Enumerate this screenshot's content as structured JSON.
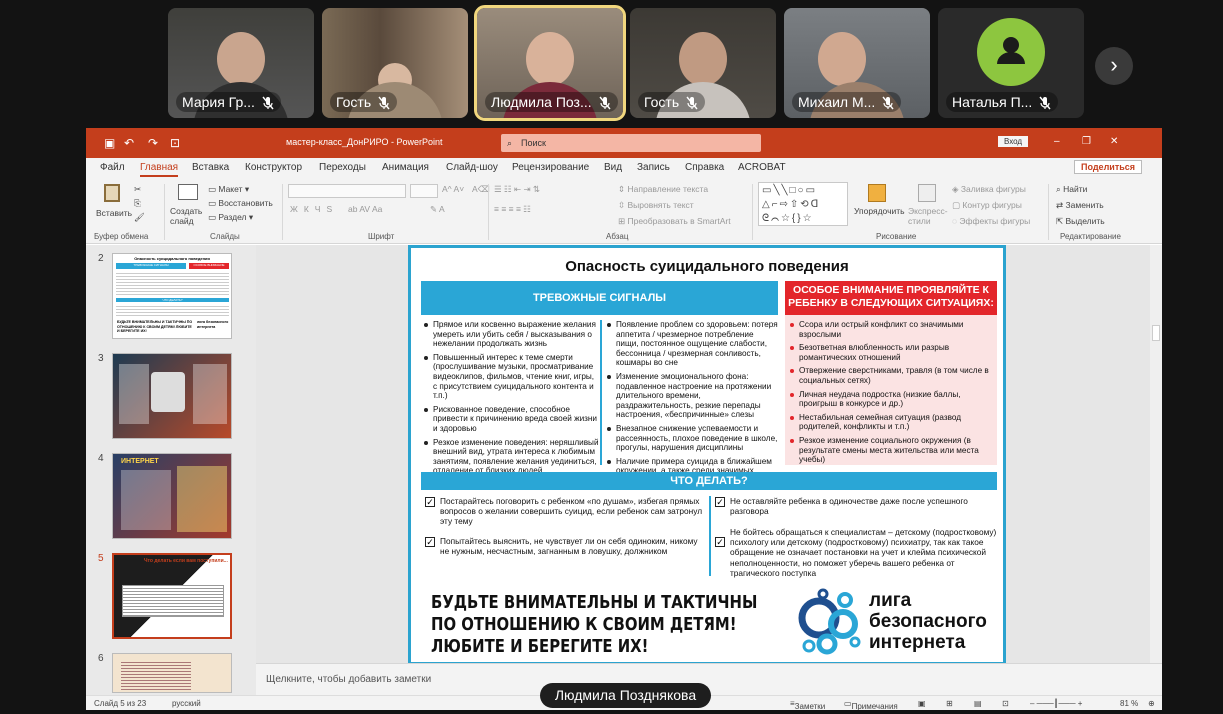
{
  "participants": [
    {
      "name": "Мария Гр...",
      "muted": true,
      "bg": "#4a4a46",
      "shirt": "#3b3b3b"
    },
    {
      "name": "Гость",
      "muted": true,
      "bg": "#6c5a49",
      "shirt": "#a08f7a"
    },
    {
      "name": "Людмила Поз...",
      "muted": true,
      "bg": "#8a7d6e",
      "shirt": "#7b2a3a",
      "active": true
    },
    {
      "name": "Гость",
      "muted": true,
      "bg": "#4f4b45",
      "shirt": "#c7c2bd"
    },
    {
      "name": "Михаил М...",
      "muted": true,
      "bg": "#6b6f73",
      "shirt": "#9a7f6b"
    },
    {
      "name": "Наталья П...",
      "muted": true,
      "avatar": true
    }
  ],
  "next_arrow": "›",
  "ppt": {
    "doc_title": "мастер-класс_ДонРИРО  -  PowerPoint",
    "search": "Поиск",
    "login": "Вход",
    "menu": [
      "Файл",
      "Главная",
      "Вставка",
      "Конструктор",
      "Переходы",
      "Анимация",
      "Слайд-шоу",
      "Рецензирование",
      "Вид",
      "Запись",
      "Справка",
      "ACROBAT"
    ],
    "share": "Поделиться",
    "ribbon": {
      "paste": "Вставить",
      "create": "Создать слайд",
      "layout": "Макет",
      "restore": "Восстановить",
      "section": "Раздел",
      "g_clip": "Буфер обмена",
      "g_slides": "Слайды",
      "g_font": "Шрифт",
      "g_para": "Абзац",
      "g_draw": "Рисование",
      "g_edit": "Редактирование",
      "text_dir": "Направление текста",
      "align_text": "Выровнять текст",
      "smartart": "Преобразовать в SmartArt",
      "arrange": "Упорядочить",
      "express": "Экспресс-стили",
      "fill": "Заливка фигуры",
      "outline": "Контур фигуры",
      "effects": "Эффекты фигуры",
      "find": "Найти",
      "replace": "Заменить",
      "select": "Выделить"
    },
    "thumb_numbers": [
      "2",
      "3",
      "4",
      "5",
      "6"
    ],
    "thumb2": {
      "title": "Опасность суицидального поведения",
      "left": "ТРЕВОЖНЫЕ СИГНАЛЫ",
      "right": "ОСОБОЕ ВНИМАНИЕ",
      "what": "ЧТО ДЕЛАТЬ?",
      "bottom": "БУДЬТЕ ВНИМАТЕЛЬНЫ И ТАКТИЧНЫ ПО ОТНОШЕНИЮ К СВОИМ ДЕТЯМ! ЛЮБИТЕ И БЕРЕГИТЕ ИХ!",
      "logo": "лига безопасного интернета"
    },
    "thumb4_title": "ИНТЕРНЕТ",
    "thumb5_title": "Что делать если вам поступили...",
    "notes": "Щелкните, чтобы добавить заметки",
    "status": {
      "slide": "Слайд 5 из 23",
      "lang": "русский",
      "notes": "Заметки",
      "comments": "Примечания",
      "zoom": "81 %"
    }
  },
  "slide": {
    "title": "Опасность суицидального поведения",
    "header_left": "ТРЕВОЖНЫЕ СИГНАЛЫ",
    "header_right": "ОСОБОЕ ВНИМАНИЕ ПРОЯВЛЯЙТЕ К РЕБЕНКУ В СЛЕДУЮЩИХ СИТУАЦИЯХ:",
    "col1": [
      "Прямое или косвенно выражение желания умереть или убить себя / высказывания о нежелании продолжать жизнь",
      "Повышенный интерес к теме смерти (прослушивание музыки, просматривание видеоклипов, фильмов, чтение книг, игры, с присутствием суицидального контента и т.п.)",
      "Рискованное поведение, способное привести к причинению вреда своей жизни и здоровью",
      "Резкое изменение поведения: неряшливый внешний вид, утрата интереса к любимым занятиям, появление желания уединиться, отдаление от близких людей, раздаривание дорогих ребенку вещей"
    ],
    "col2": [
      "Появление проблем со здоровьем: потеря аппетита / чрезмерное потребление пищи, постоянное ощущение слабости, бессонница / чрезмерная сонливость, кошмары во сне",
      "Изменение эмоционального фона: подавленное настроение на протяжении длительного времени, раздражительность, резкие перепады настроения, «беспричинные» слезы",
      "Внезапное снижение успеваемости и рассеянность, плохое поведение в школе, прогулы, нарушения дисциплины",
      "Наличие примера суицида в ближайшем окружении, а также среди значимых взрослых или сверстников, кумиров"
    ],
    "col3": [
      "Ссора или острый конфликт со значимыми взрослыми",
      "Безответная влюбленность или разрыв романтических отношений",
      "Отвержение сверстниками, травля (в том числе в социальных сетях)",
      "Личная неудача подростка (низкие баллы, проигрыш в конкурсе и др.)",
      "Нестабильная семейная ситуация (развод родителей, конфликты и т.п.)",
      "Резкое изменение социального окружения (в результате смены места жительства или места учебы)"
    ],
    "header_center": "ЧТО ДЕЛАТЬ?",
    "what1": "Постарайтесь поговорить с ребенком «по душам», избегая прямых вопросов о желании совершить суицид, если ребенок сам затронул эту тему",
    "what2": "Попытайтесь выяснить, не чувствует ли он себя одиноким, никому не нужным, несчастным, загнанным в ловушку, должником",
    "what3": "Не оставляйте ребенка в одиночестве даже после успешного разговора",
    "what4": "Не бойтесь обращаться к специалистам – детскому (подростковому) психологу или детскому (подростковому) психиатру, так как такое обращение не означает постановки на учет и клейма психической неполноценности, но поможет уберечь вашего ребенка от трагического поступка",
    "big_line1": "БУДЬТЕ ВНИМАТЕЛЬНЫ И ТАКТИЧНЫ",
    "big_line2": "ПО ОТНОШЕНИЮ К СВОИМ ДЕТЯМ!",
    "big_line3": "ЛЮБИТЕ И БЕРЕГИТЕ ИХ!",
    "logo_line1": "лига",
    "logo_line2": "безопасного",
    "logo_line3": "интернета"
  },
  "caption": "Людмила Позднякова",
  "colors": {
    "ppt_red": "#c43e1c",
    "slide_blue": "#2aa6d6",
    "slide_red": "#e3262b",
    "avatar_green": "#8dc63f"
  }
}
